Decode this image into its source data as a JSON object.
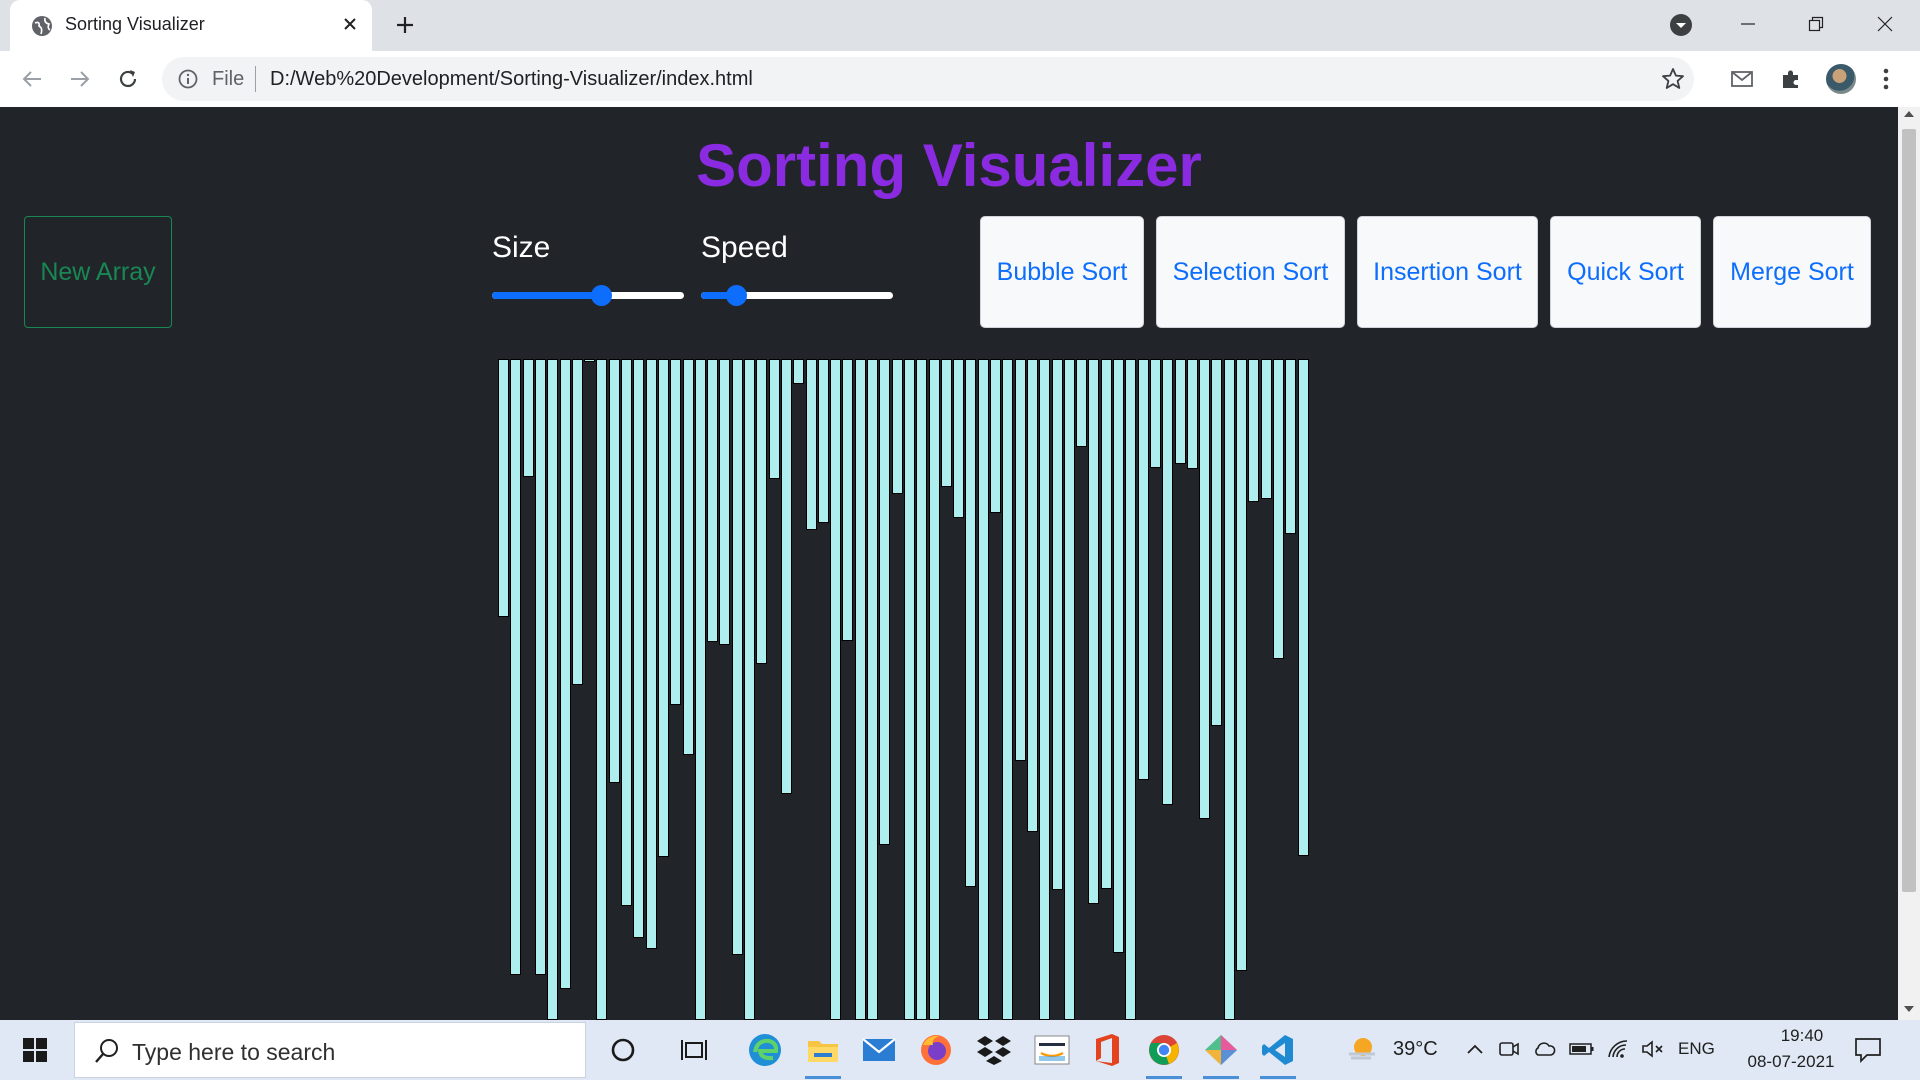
{
  "browser": {
    "tab_title": "Sorting Visualizer",
    "url_scheme": "File",
    "url": "D:/Web%20Development/Sorting-Visualizer/index.html"
  },
  "page": {
    "title": "Sorting Visualizer",
    "new_array_label": "New Array",
    "size_label": "Size",
    "speed_label": "Speed",
    "size_fraction": 0.57,
    "speed_fraction": 0.18,
    "algorithms": [
      "Bubble Sort",
      "Selection Sort",
      "Insertion Sort",
      "Quick Sort",
      "Merge Sort"
    ],
    "colors": {
      "title": "#8a2be2",
      "new_array": "#198754",
      "button_text": "#0d6efd",
      "bar": "#afeeee",
      "background": "#212529"
    },
    "bar_values": [
      258,
      616,
      118,
      616,
      661,
      630,
      326,
      2,
      661,
      424,
      547,
      579,
      590,
      498,
      346,
      396,
      661,
      283,
      286,
      596,
      661,
      305,
      120,
      435,
      25,
      171,
      164,
      661,
      282,
      661,
      661,
      486,
      135,
      661,
      661,
      661,
      128,
      159,
      528,
      661,
      154,
      661,
      402,
      473,
      661,
      531,
      661,
      88,
      545,
      530,
      594,
      661,
      421,
      109,
      446,
      105,
      110,
      460,
      367,
      661,
      612,
      143,
      140,
      300,
      175,
      497
    ]
  },
  "taskbar": {
    "search_placeholder": "Type here to search",
    "weather": "39°C",
    "language": "ENG",
    "time": "19:40",
    "date": "08-07-2021"
  }
}
